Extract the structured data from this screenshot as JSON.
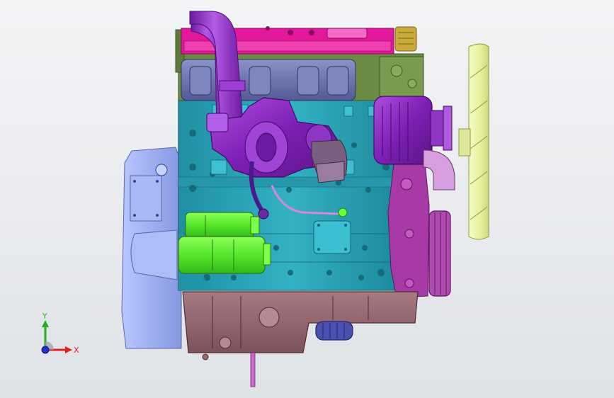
{
  "viewport": {
    "background_top": "#f3f4f6",
    "background_bottom": "#dfe2e6"
  },
  "model": {
    "components": [
      {
        "name": "engine-block",
        "color": "#2aa6b8"
      },
      {
        "name": "valve-cover",
        "color": "#e0199a"
      },
      {
        "name": "cylinder-head",
        "color": "#6b8a45"
      },
      {
        "name": "exhaust-manifold",
        "color": "#6c73ad"
      },
      {
        "name": "intake-pipe",
        "color": "#8b21c4"
      },
      {
        "name": "turbocharger",
        "color": "#8b21c4"
      },
      {
        "name": "alternator",
        "color": "#9a2fb8"
      },
      {
        "name": "starter-motor",
        "color": "#66ff33"
      },
      {
        "name": "flywheel-housing",
        "color": "#9fb0f2"
      },
      {
        "name": "oil-pan",
        "color": "#9a6a72"
      },
      {
        "name": "cooling-fan",
        "color": "#ecf5a6"
      },
      {
        "name": "crank-pulley",
        "color": "#a83aa8"
      },
      {
        "name": "oil-filter",
        "color": "#4a4fb0"
      },
      {
        "name": "oil-fill-cap",
        "color": "#c9a93a"
      },
      {
        "name": "dipstick-tube",
        "color": "#cc66cc"
      }
    ]
  },
  "triad": {
    "x_label": "X",
    "y_label": "Y",
    "x_color": "#e02020",
    "y_color": "#20b020",
    "z_color": "#2030d0"
  }
}
